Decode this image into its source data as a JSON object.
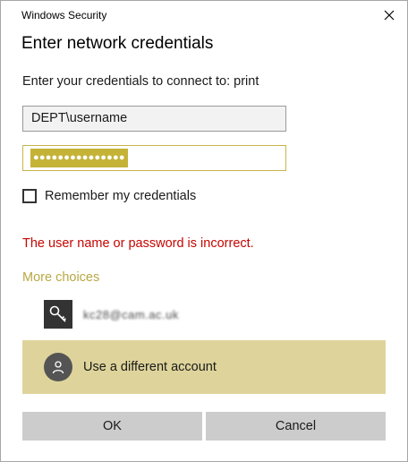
{
  "window": {
    "title": "Windows Security"
  },
  "dialog": {
    "heading": "Enter network credentials",
    "prompt": "Enter your credentials to connect to: print"
  },
  "fields": {
    "username_value": "DEPT\\username",
    "password_mask": "●●●●●●●●●●●●●●●"
  },
  "remember": {
    "label": "Remember my credentials",
    "checked": false
  },
  "error": {
    "message": "The user name or password is incorrect."
  },
  "more_choices": {
    "label": "More choices"
  },
  "accounts": {
    "saved_label": "kc28@cam.ac.uk",
    "different_label": "Use a different account"
  },
  "buttons": {
    "ok": "OK",
    "cancel": "Cancel"
  },
  "icons": {
    "close": "close-icon",
    "key": "key-icon",
    "person": "person-icon"
  },
  "colors": {
    "accent": "#c4b336",
    "selected_row": "#ded49b",
    "error": "#c50500",
    "link": "#b9a844"
  }
}
